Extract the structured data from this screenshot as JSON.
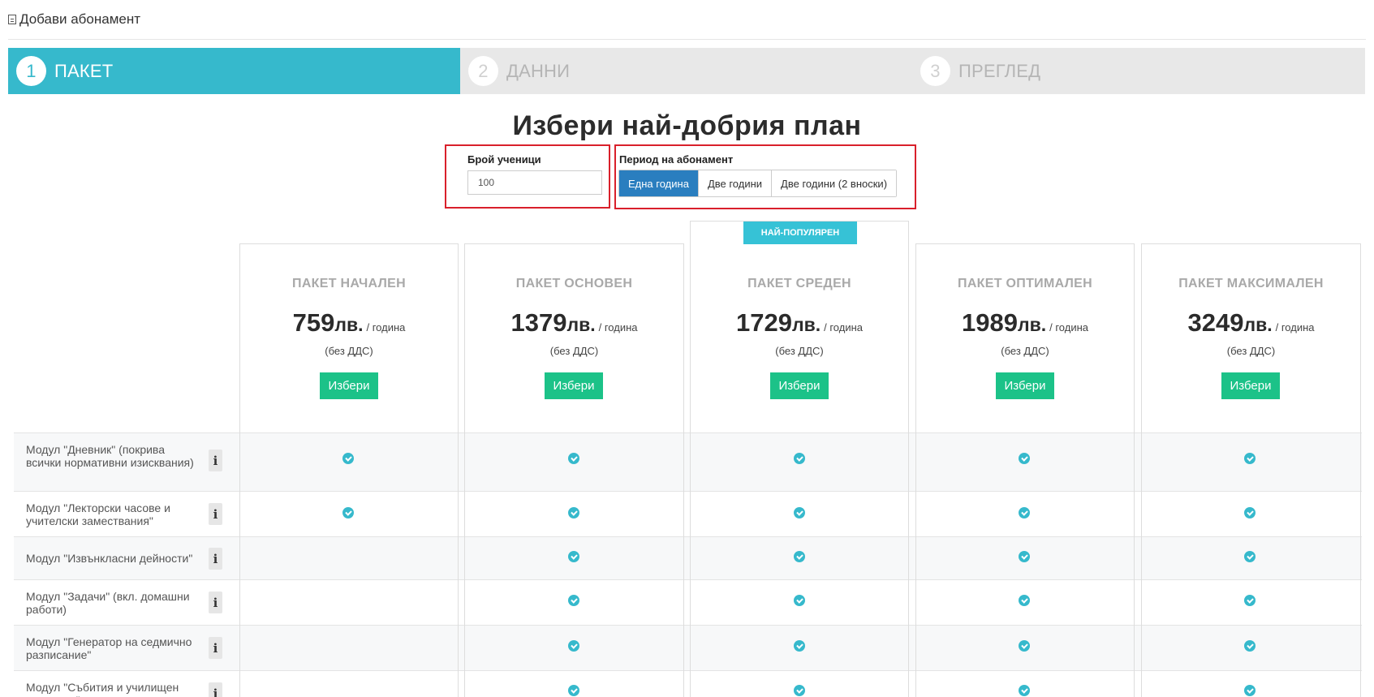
{
  "header": {
    "title": "Добави абонамент",
    "icon": "document-icon"
  },
  "wizard": {
    "steps": [
      {
        "num": "1",
        "label": "ПАКЕТ",
        "active": true
      },
      {
        "num": "2",
        "label": "ДАННИ",
        "active": false
      },
      {
        "num": "3",
        "label": "ПРЕГЛЕД",
        "active": false
      }
    ]
  },
  "title": "Избери най-добрия план",
  "students": {
    "label": "Брой ученици",
    "value": "100"
  },
  "period": {
    "label": "Период на абонамент",
    "options": [
      "Една година",
      "Две години",
      "Две години (2 вноски)"
    ],
    "selected": "Една година"
  },
  "popular_badge": "НАЙ-ПОПУЛЯРЕН",
  "packages": [
    {
      "name": "ПАКЕТ НАЧАЛЕН",
      "price": "759",
      "currency": "лв.",
      "period": "/ година",
      "vat": "(без ДДС)",
      "button": "Избери"
    },
    {
      "name": "ПАКЕТ ОСНОВЕН",
      "price": "1379",
      "currency": "лв.",
      "period": "/ година",
      "vat": "(без ДДС)",
      "button": "Избери"
    },
    {
      "name": "ПАКЕТ СРЕДЕН",
      "price": "1729",
      "currency": "лв.",
      "period": "/ година",
      "vat": "(без ДДС)",
      "button": "Избери"
    },
    {
      "name": "ПАКЕТ ОПТИМАЛЕН",
      "price": "1989",
      "currency": "лв.",
      "period": "/ година",
      "vat": "(без ДДС)",
      "button": "Избери"
    },
    {
      "name": "ПАКЕТ МАКСИМАЛЕН",
      "price": "3249",
      "currency": "лв.",
      "period": "/ година",
      "vat": "(без ДДС)",
      "button": "Избери"
    }
  ],
  "features": [
    {
      "label": "Модул \"Дневник\" (покрива всички нормативни изисквания)",
      "included": [
        true,
        true,
        true,
        true,
        true
      ]
    },
    {
      "label": "Модул \"Лекторски часове и учителски замествания\"",
      "included": [
        true,
        true,
        true,
        true,
        true
      ]
    },
    {
      "label": "Модул \"Извънкласни дейности\"",
      "included": [
        false,
        true,
        true,
        true,
        true
      ]
    },
    {
      "label": "Модул \"Задачи\" (вкл. домашни работи)",
      "included": [
        false,
        true,
        true,
        true,
        true
      ]
    },
    {
      "label": "Модул \"Генератор на седмично разписание\"",
      "included": [
        false,
        true,
        true,
        true,
        true
      ]
    },
    {
      "label": "Модул \"Събития и училищен календар\"",
      "included": [
        false,
        true,
        true,
        true,
        true
      ]
    }
  ],
  "info_glyph": "i",
  "colors": {
    "accent": "#36b9cc",
    "active_button": "#2a7ebf",
    "choose_button": "#1cc288",
    "highlight": "#d9202b"
  }
}
